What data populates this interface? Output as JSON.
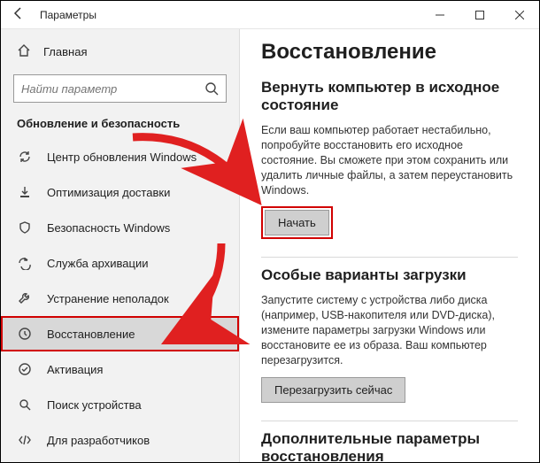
{
  "titlebar": {
    "title": "Параметры"
  },
  "sidebar": {
    "home_label": "Главная",
    "search_placeholder": "Найти параметр",
    "section_title": "Обновление и безопасность",
    "items": [
      {
        "label": "Центр обновления Windows",
        "icon": "sync-icon"
      },
      {
        "label": "Оптимизация доставки",
        "icon": "delivery-icon"
      },
      {
        "label": "Безопасность Windows",
        "icon": "shield-icon"
      },
      {
        "label": "Служба архивации",
        "icon": "backup-icon"
      },
      {
        "label": "Устранение неполадок",
        "icon": "troubleshoot-icon"
      },
      {
        "label": "Восстановление",
        "icon": "recovery-icon"
      },
      {
        "label": "Активация",
        "icon": "activation-icon"
      },
      {
        "label": "Поиск устройства",
        "icon": "find-device-icon"
      },
      {
        "label": "Для разработчиков",
        "icon": "developer-icon"
      }
    ]
  },
  "content": {
    "page_title": "Восстановление",
    "reset": {
      "heading": "Вернуть компьютер в исходное состояние",
      "text": "Если ваш компьютер работает нестабильно, попробуйте восстановить его исходное состояние. Вы сможете при этом сохранить или удалить личные файлы, а затем переустановить Windows.",
      "button": "Начать"
    },
    "advanced": {
      "heading": "Особые варианты загрузки",
      "text": "Запустите систему с устройства либо диска (например, USB-накопителя или DVD-диска), измените параметры загрузки Windows или восстановите ее из образа. Ваш компьютер перезагрузится.",
      "button": "Перезагрузить сейчас"
    },
    "more": {
      "heading": "Дополнительные параметры восстановления"
    }
  },
  "annotations": {
    "arrow_color": "#e02020"
  }
}
